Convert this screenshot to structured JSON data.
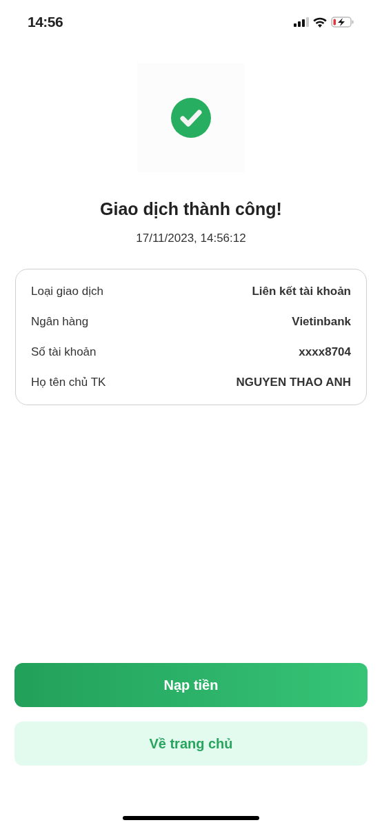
{
  "status_bar": {
    "time": "14:56"
  },
  "result": {
    "title": "Giao dịch thành công!",
    "timestamp": "17/11/2023, 14:56:12"
  },
  "details": [
    {
      "label": "Loại giao dịch",
      "value": "Liên kết tài khoản"
    },
    {
      "label": "Ngân hàng",
      "value": "Vietinbank"
    },
    {
      "label": "Số tài khoản",
      "value": "xxxx8704"
    },
    {
      "label": "Họ tên chủ TK",
      "value": "NGUYEN THAO ANH"
    }
  ],
  "buttons": [
    {
      "label": "Nạp tiền",
      "kind": "primary"
    },
    {
      "label": "Về trang chủ",
      "kind": "secondary"
    }
  ]
}
